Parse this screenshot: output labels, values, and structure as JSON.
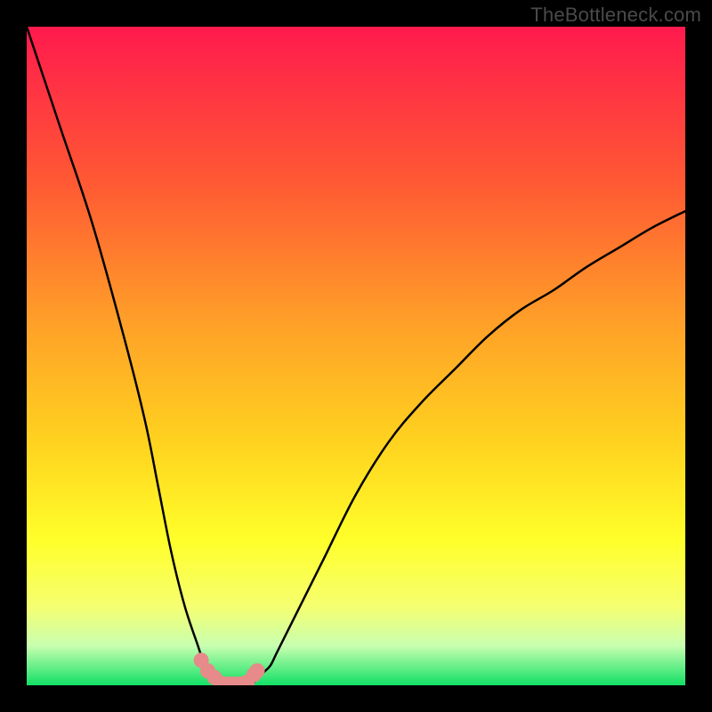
{
  "watermark": "TheBottleneck.com",
  "chart_data": {
    "type": "line",
    "title": "",
    "xlabel": "",
    "ylabel": "",
    "xlim": [
      0,
      100
    ],
    "ylim": [
      0,
      100
    ],
    "x": [
      0,
      5,
      10,
      15,
      18,
      20,
      22,
      24,
      26,
      27,
      28,
      29,
      30,
      31,
      32,
      33,
      34,
      35,
      36,
      37,
      38,
      40,
      42,
      45,
      50,
      55,
      60,
      65,
      70,
      75,
      80,
      85,
      90,
      95,
      100
    ],
    "y": [
      100,
      85,
      70,
      52,
      40,
      30,
      20,
      12,
      6,
      3,
      1,
      0,
      0,
      0,
      0,
      0,
      0,
      1,
      2,
      3,
      5,
      9,
      13,
      19,
      29,
      37,
      43,
      48,
      53,
      57,
      60,
      63.5,
      66.5,
      69.5,
      72
    ],
    "series_name": "bottleneck-curve",
    "markers": {
      "x": [
        26.5,
        27.5,
        28.5,
        29.5,
        30.5,
        31.5,
        32.5,
        33.5,
        34.5,
        35.0
      ],
      "y": [
        3.8,
        2.2,
        1.2,
        0.3,
        0.2,
        0.2,
        0.2,
        0.5,
        1.6,
        2.2
      ],
      "color": "#e68a8a",
      "size": 8.5
    },
    "gradient_stops": [
      {
        "offset": 0.0,
        "color": "#ff1a4d"
      },
      {
        "offset": 0.24,
        "color": "#ff5a33"
      },
      {
        "offset": 0.45,
        "color": "#ffa028"
      },
      {
        "offset": 0.63,
        "color": "#ffd21f"
      },
      {
        "offset": 0.78,
        "color": "#ffff2a"
      },
      {
        "offset": 0.88,
        "color": "#f6ff70"
      },
      {
        "offset": 0.94,
        "color": "#c8ffb0"
      },
      {
        "offset": 1.0,
        "color": "#12e066"
      }
    ]
  }
}
